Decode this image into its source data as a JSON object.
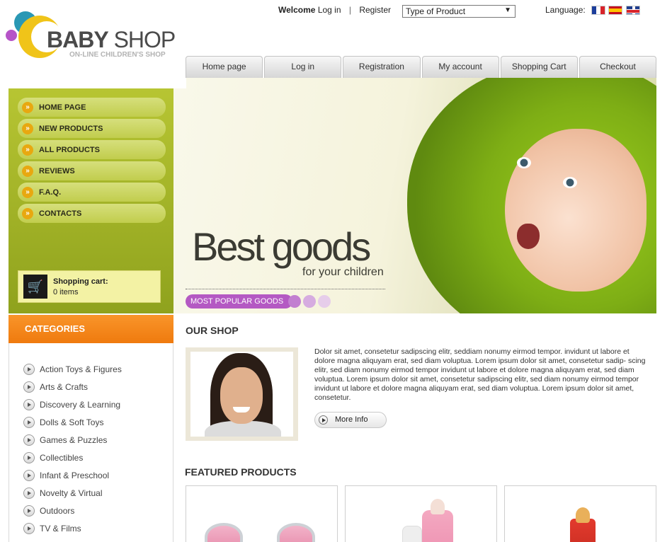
{
  "header": {
    "logo_name_bold": "BABY",
    "logo_name_rest": " SHOP",
    "logo_tagline": "ON-LINE CHILDREN'S SHOP",
    "welcome": "Welcome",
    "login_link": "Log in",
    "separator": "|",
    "register_link": "Register",
    "product_type_selected": "Type of Product",
    "language_label": "Language:",
    "flags": [
      "flag-fr-icon",
      "flag-es-icon",
      "flag-uk-icon"
    ]
  },
  "tabs": [
    "Home page",
    "Log in",
    "Registration",
    "My account",
    "Shopping Cart",
    "Checkout"
  ],
  "sidebar": {
    "menu": [
      "HOME PAGE",
      "NEW PRODUCTS",
      "ALL PRODUCTS",
      "REVIEWS",
      "F.A.Q.",
      "CONTACTS"
    ],
    "cart_title": "Shopping cart:",
    "cart_items": "0 items",
    "categories_title": "CATEGORIES",
    "categories": [
      "Action Toys & Figures",
      "Arts & Crafts",
      "Discovery & Learning",
      "Dolls & Soft Toys",
      "Games & Puzzles",
      "Collectibles",
      "Infant & Preschool",
      "Novelty & Virtual",
      "Outdoors",
      "TV & Films"
    ]
  },
  "banner": {
    "headline": "Best goods",
    "subhead": "for your children",
    "popular_label": "MOST POPULAR GOODS"
  },
  "our_shop": {
    "title": "OUR SHOP",
    "text": "Dolor sit amet, consetetur sadipscing elitr, seddiam nonumy eirmod tempor. invidunt ut labore et dolore magna aliquyam erat, sed diam voluptua. Lorem ipsum dolor sit amet, consetetur sadip- scing elitr, sed diam nonumy eirmod tempor invidunt ut labore et dolore magna aliquyam erat, sed diam voluptua. Lorem ipsum dolor sit amet, consetetur sadipscing elitr, sed diam nonumy eirmod tempor invidunt ut labore et dolore magna aliquyam erat, sed diam voluptua. Lorem ipsum dolor sit amet, consetetur.",
    "more_info": "More Info"
  },
  "featured": {
    "title": "FEATURED PRODUCTS"
  },
  "colors": {
    "sidebar_green": "#a4b52a",
    "category_orange": "#f5891c",
    "popular_purple": "#b459c3",
    "cart_yellow": "#f3f2a4"
  }
}
